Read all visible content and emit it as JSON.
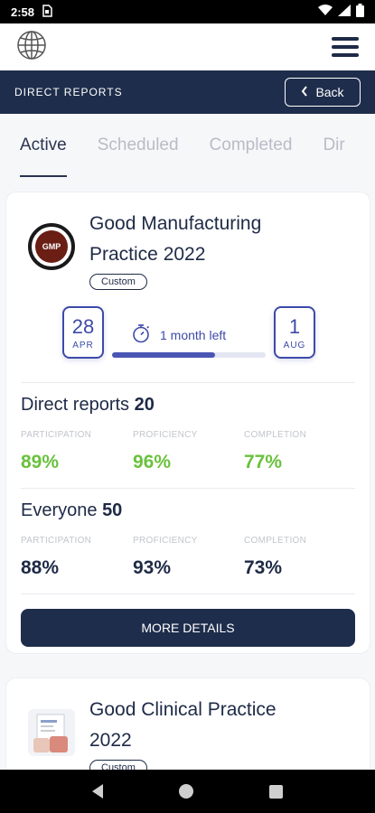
{
  "status_bar": {
    "time": "2:58",
    "sim_icon": "sim-card-icon",
    "wifi_icon": "wifi-icon",
    "signal_icon": "signal-icon",
    "battery_icon": "battery-icon"
  },
  "header": {
    "logo_icon": "globe-icon",
    "menu_icon": "hamburger-menu-icon"
  },
  "page_bar": {
    "title": "DIRECT REPORTS",
    "back_label": "Back"
  },
  "tabs": [
    {
      "label": "Active"
    },
    {
      "label": "Scheduled"
    },
    {
      "label": "Completed"
    },
    {
      "label": "Dir"
    }
  ],
  "courses": [
    {
      "logo_text": "GMP",
      "title_line1": "Good Manufacturing",
      "title_line2": "Practice 2022",
      "badge": "Custom",
      "start_day": "28",
      "start_month": "APR",
      "end_day": "1",
      "end_month": "AUG",
      "time_left": "1 month left",
      "time_progress": 0.67,
      "direct_reports": {
        "label": "Direct reports",
        "count": "20",
        "participation_label": "PARTICIPATION",
        "participation": "89%",
        "proficiency_label": "PROFICIENCY",
        "proficiency": "96%",
        "completion_label": "COMPLETION",
        "completion": "77%"
      },
      "everyone": {
        "label": "Everyone",
        "count": "50",
        "participation_label": "PARTICIPATION",
        "participation": "88%",
        "proficiency_label": "PROFICIENCY",
        "proficiency": "93%",
        "completion_label": "COMPLETION",
        "completion": "73%"
      },
      "more_details_label": "MORE DETAILS"
    },
    {
      "title_line1": "Good Clinical Practice",
      "title_line2": "2022",
      "badge": "Custom"
    }
  ],
  "colors": {
    "navy": "#1e2d4b",
    "accent": "#3d4aa8",
    "green": "#6ac13d"
  }
}
